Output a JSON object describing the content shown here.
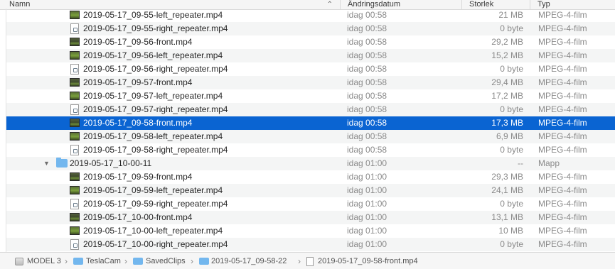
{
  "header": {
    "name": "Namn",
    "date": "Ändringsdatum",
    "size": "Storlek",
    "type": "Typ"
  },
  "rows": [
    {
      "name": "2019-05-17_09-55-left_repeater.mp4",
      "date": "idag 00:58",
      "size": "21 MB",
      "type": "MPEG-4-film"
    },
    {
      "name": "2019-05-17_09-55-right_repeater.mp4",
      "date": "idag 00:58",
      "size": "0 byte",
      "type": "MPEG-4-film"
    },
    {
      "name": "2019-05-17_09-56-front.mp4",
      "date": "idag 00:58",
      "size": "29,2 MB",
      "type": "MPEG-4-film"
    },
    {
      "name": "2019-05-17_09-56-left_repeater.mp4",
      "date": "idag 00:58",
      "size": "15,2 MB",
      "type": "MPEG-4-film"
    },
    {
      "name": "2019-05-17_09-56-right_repeater.mp4",
      "date": "idag 00:58",
      "size": "0 byte",
      "type": "MPEG-4-film"
    },
    {
      "name": "2019-05-17_09-57-front.mp4",
      "date": "idag 00:58",
      "size": "29,4 MB",
      "type": "MPEG-4-film"
    },
    {
      "name": "2019-05-17_09-57-left_repeater.mp4",
      "date": "idag 00:58",
      "size": "17,2 MB",
      "type": "MPEG-4-film"
    },
    {
      "name": "2019-05-17_09-57-right_repeater.mp4",
      "date": "idag 00:58",
      "size": "0 byte",
      "type": "MPEG-4-film"
    },
    {
      "name": "2019-05-17_09-58-front.mp4",
      "date": "idag 00:58",
      "size": "17,3 MB",
      "type": "MPEG-4-film"
    },
    {
      "name": "2019-05-17_09-58-left_repeater.mp4",
      "date": "idag 00:58",
      "size": "6,9 MB",
      "type": "MPEG-4-film"
    },
    {
      "name": "2019-05-17_09-58-right_repeater.mp4",
      "date": "idag 00:58",
      "size": "0 byte",
      "type": "MPEG-4-film"
    },
    {
      "name": "2019-05-17_10-00-11",
      "date": "idag 01:00",
      "size": "--",
      "type": "Mapp"
    },
    {
      "name": "2019-05-17_09-59-front.mp4",
      "date": "idag 01:00",
      "size": "29,3 MB",
      "type": "MPEG-4-film"
    },
    {
      "name": "2019-05-17_09-59-left_repeater.mp4",
      "date": "idag 01:00",
      "size": "24,1 MB",
      "type": "MPEG-4-film"
    },
    {
      "name": "2019-05-17_09-59-right_repeater.mp4",
      "date": "idag 01:00",
      "size": "0 byte",
      "type": "MPEG-4-film"
    },
    {
      "name": "2019-05-17_10-00-front.mp4",
      "date": "idag 01:00",
      "size": "13,1 MB",
      "type": "MPEG-4-film"
    },
    {
      "name": "2019-05-17_10-00-left_repeater.mp4",
      "date": "idag 01:00",
      "size": "10 MB",
      "type": "MPEG-4-film"
    },
    {
      "name": "2019-05-17_10-00-right_repeater.mp4",
      "date": "idag 01:00",
      "size": "0 byte",
      "type": "MPEG-4-film"
    }
  ],
  "pathbar": {
    "disk": "MODEL 3",
    "folder1": "TeslaCam",
    "folder2": "SavedClips",
    "folder3": "2019-05-17_09-58-22",
    "file": "2019-05-17_09-58-front.mp4"
  },
  "colors": {
    "selection": "#0a64d2",
    "folder": "#73b7ee"
  }
}
